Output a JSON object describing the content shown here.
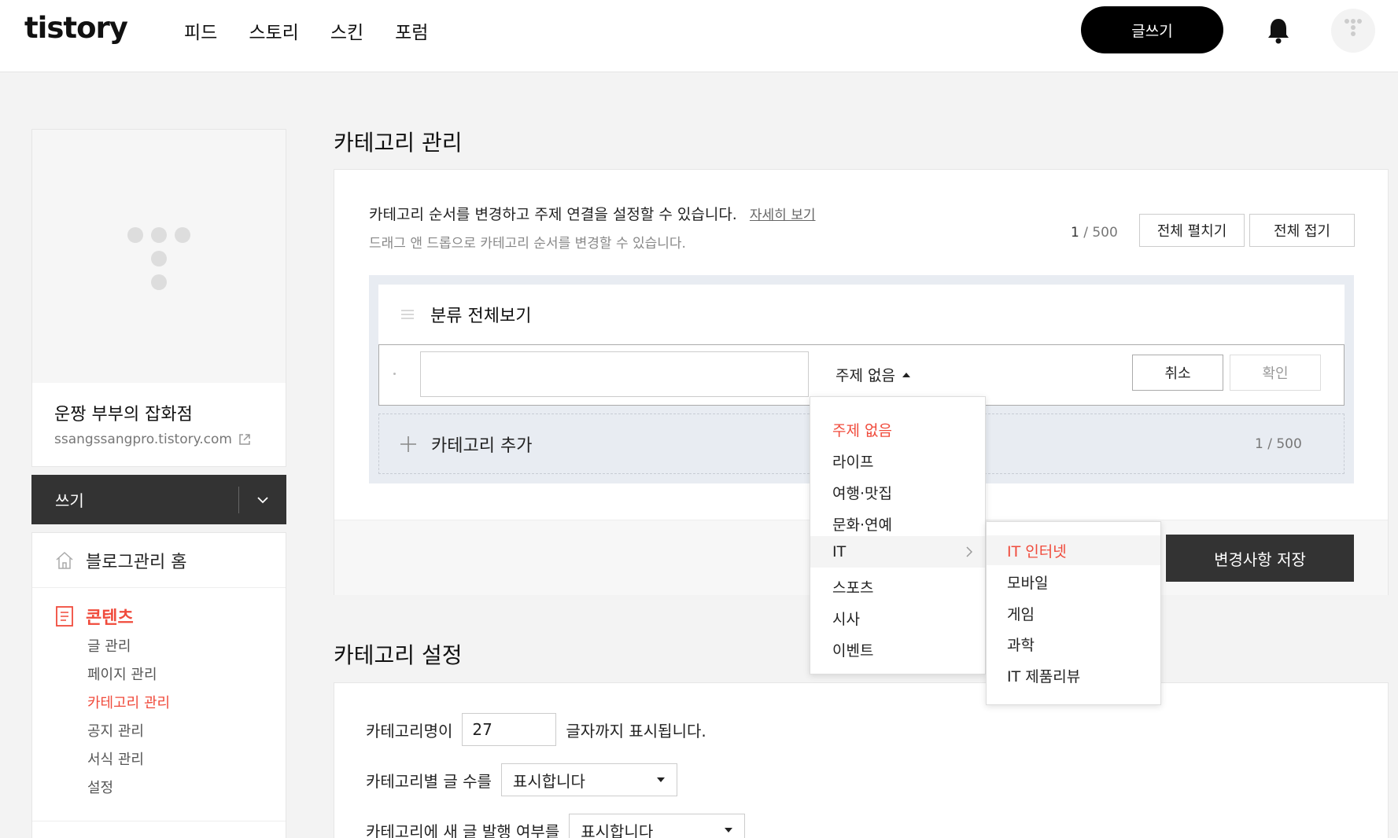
{
  "header": {
    "logo": "tistory",
    "nav": [
      "피드",
      "스토리",
      "스킨",
      "포럼"
    ],
    "write_button": "글쓰기"
  },
  "sidebar": {
    "blog_name": "운짱 부부의 잡화점",
    "blog_url": "ssangssangpro.tistory.com",
    "write_label": "쓰기",
    "home_label": "블로그관리 홈",
    "contents_label": "콘텐츠",
    "submenu": [
      "글 관리",
      "페이지 관리",
      "카테고리 관리",
      "공지 관리",
      "서식 관리",
      "설정"
    ],
    "active_submenu": "카테고리 관리"
  },
  "category_manage": {
    "title": "카테고리 관리",
    "description": "카테고리 순서를 변경하고 주제 연결을 설정할 수 있습니다.",
    "detail_link": "자세히 보기",
    "drag_hint": "드래그 앤 드롭으로 카테고리 순서를 변경할 수 있습니다.",
    "count_current": "1",
    "count_max": " / 500",
    "expand_all": "전체 펼치기",
    "collapse_all": "전체 접기",
    "all_categories": "분류 전체보기",
    "edit_input_value": "",
    "topic_selected": "주제 없음",
    "cancel": "취소",
    "confirm": "확인",
    "add_category": "카테고리 추가",
    "add_count": "1 / 500",
    "save_changes": "변경사항 저장"
  },
  "topic_dropdown": {
    "items": [
      "주제 없음",
      "라이프",
      "여행·맛집",
      "문화·연예",
      "IT",
      "스포츠",
      "시사",
      "이벤트"
    ],
    "selected": "주제 없음",
    "hovered": "IT",
    "sub_items": [
      "IT 인터넷",
      "모바일",
      "게임",
      "과학",
      "IT 제품리뷰"
    ],
    "sub_selected": "IT 인터넷"
  },
  "category_settings": {
    "title": "카테고리 설정",
    "name_len_label": "카테고리명이",
    "name_len_value": "27",
    "name_len_suffix": "글자까지 표시됩니다.",
    "post_count_label": "카테고리별 글 수를",
    "post_count_value": "표시합니다",
    "new_post_label": "카테고리에 새 글 발행 여부를",
    "new_post_value": "표시합니다"
  },
  "colors": {
    "accent": "#f04b3c",
    "dark": "#333333",
    "header_btn": "#000000"
  }
}
